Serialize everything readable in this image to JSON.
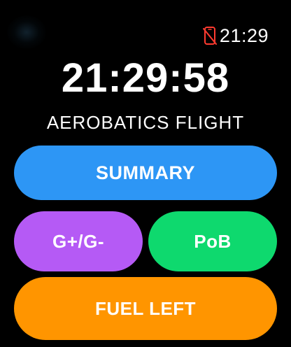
{
  "status_bar": {
    "icon": "phone-disconnected-icon",
    "icon_color": "#ff3b30",
    "time": "21:29"
  },
  "clock": {
    "time": "21:29:58"
  },
  "title": "AEROBATICS FLIGHT",
  "buttons": {
    "summary": {
      "label": "SUMMARY",
      "color": "#2d96f5"
    },
    "g_force": {
      "label": "G+/G-",
      "color": "#b55af5"
    },
    "pob": {
      "label": "PoB",
      "color": "#0ed96e"
    },
    "fuel_left": {
      "label": "FUEL LEFT",
      "color": "#ff9500"
    }
  }
}
